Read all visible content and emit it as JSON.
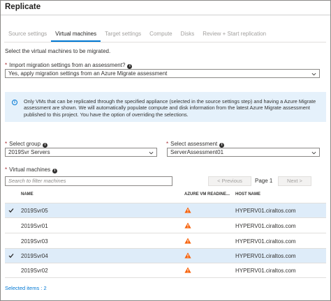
{
  "header": {
    "title": "Replicate"
  },
  "tabs": [
    {
      "label": "Source settings",
      "active": false
    },
    {
      "label": "Virtual machines",
      "active": true
    },
    {
      "label": "Target settings",
      "active": false
    },
    {
      "label": "Compute",
      "active": false
    },
    {
      "label": "Disks",
      "active": false
    },
    {
      "label": "Review + Start replication",
      "active": false
    }
  ],
  "intro": "Select the virtual machines to be migrated.",
  "import_settings": {
    "label": "Import migration settings from an assessment?",
    "value": "Yes, apply migration settings from an Azure Migrate assessment"
  },
  "info_banner": {
    "text": "Only VMs that can be replicated through the specified appliance (selected  in the source settings step) and having a Azure Migrate assessment are shown. We will automatically populate compute and disk information from the latest Azure Migrate assessment published to this project. You have the option of overriding the selections."
  },
  "select_group": {
    "label": "Select group",
    "value": "2019Svr Servers"
  },
  "select_assessment": {
    "label": "Select assessment",
    "value": "ServerAssessment01"
  },
  "virtual_machines": {
    "label": "Virtual machines",
    "search_placeholder": "Search to filter machines",
    "pager": {
      "previous": "< Previous",
      "page": "Page 1",
      "next": "Next >"
    },
    "columns": {
      "name": "NAME",
      "readiness": "AZURE VM READINE...",
      "host": "HOST NAME"
    },
    "rows": [
      {
        "name": "2019Svr05",
        "host": "HYPERV01.ciraltos.com",
        "selected": true,
        "readiness": "warning-icon"
      },
      {
        "name": "2019Svr01",
        "host": "HYPERV01.ciraltos.com",
        "selected": false,
        "readiness": "warning-icon"
      },
      {
        "name": "2019Svr03",
        "host": "HYPERV01.ciraltos.com",
        "selected": false,
        "readiness": "warning-icon"
      },
      {
        "name": "2019Svr04",
        "host": "HYPERV01.ciraltos.com",
        "selected": true,
        "readiness": "warning-icon"
      },
      {
        "name": "2019Svr02",
        "host": "HYPERV01.ciraltos.com",
        "selected": false,
        "readiness": "warning-icon"
      }
    ]
  },
  "footer": {
    "selected_items": "Selected items : 2"
  },
  "colors": {
    "accent": "#0078d4",
    "warning": "#f7630c",
    "selected_row": "#deecf9",
    "info_banner": "#e5f1fb",
    "required": "#a4262c"
  }
}
